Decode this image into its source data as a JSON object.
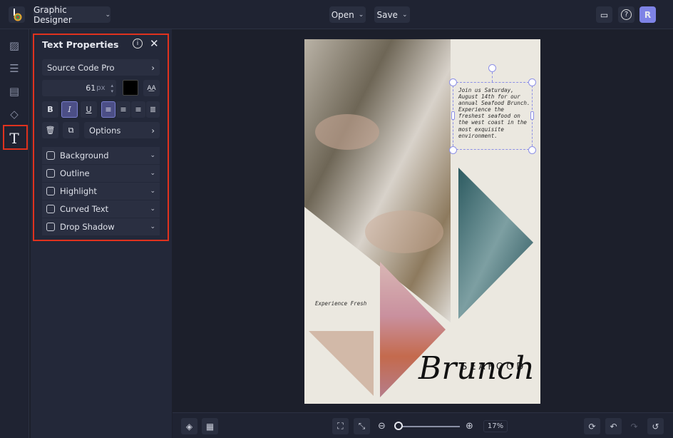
{
  "topbar": {
    "app_mode": "Graphic Designer",
    "open_label": "Open",
    "save_label": "Save",
    "avatar_initial": "R"
  },
  "rail": {
    "items": [
      "image-icon",
      "adjustments-icon",
      "layout-icon",
      "shapes-icon",
      "text-icon"
    ],
    "active": "text-icon"
  },
  "panel": {
    "title": "Text Properties",
    "font": "Source Code Pro",
    "font_size": "61",
    "font_size_unit": "px",
    "text_color": "#000000",
    "format": {
      "bold": "B",
      "italic": "I",
      "underline": "U",
      "italic_active": true,
      "align": "left"
    },
    "options_label": "Options",
    "sections": [
      {
        "label": "Background",
        "checked": false
      },
      {
        "label": "Outline",
        "checked": false
      },
      {
        "label": "Highlight",
        "checked": false
      },
      {
        "label": "Curved Text",
        "checked": false
      },
      {
        "label": "Drop Shadow",
        "checked": false
      }
    ]
  },
  "poster": {
    "body_text": "Join us Saturday, August 14th for our annual Seafood Brunch. Experience the freshest seafood on the west coast in the most exquisite environment.",
    "tagline": "Experience Fresh",
    "title_small": "SEAFOOD",
    "title_script": "Brunch"
  },
  "bottombar": {
    "zoom": "17%",
    "zoom_fraction": 0.0
  }
}
